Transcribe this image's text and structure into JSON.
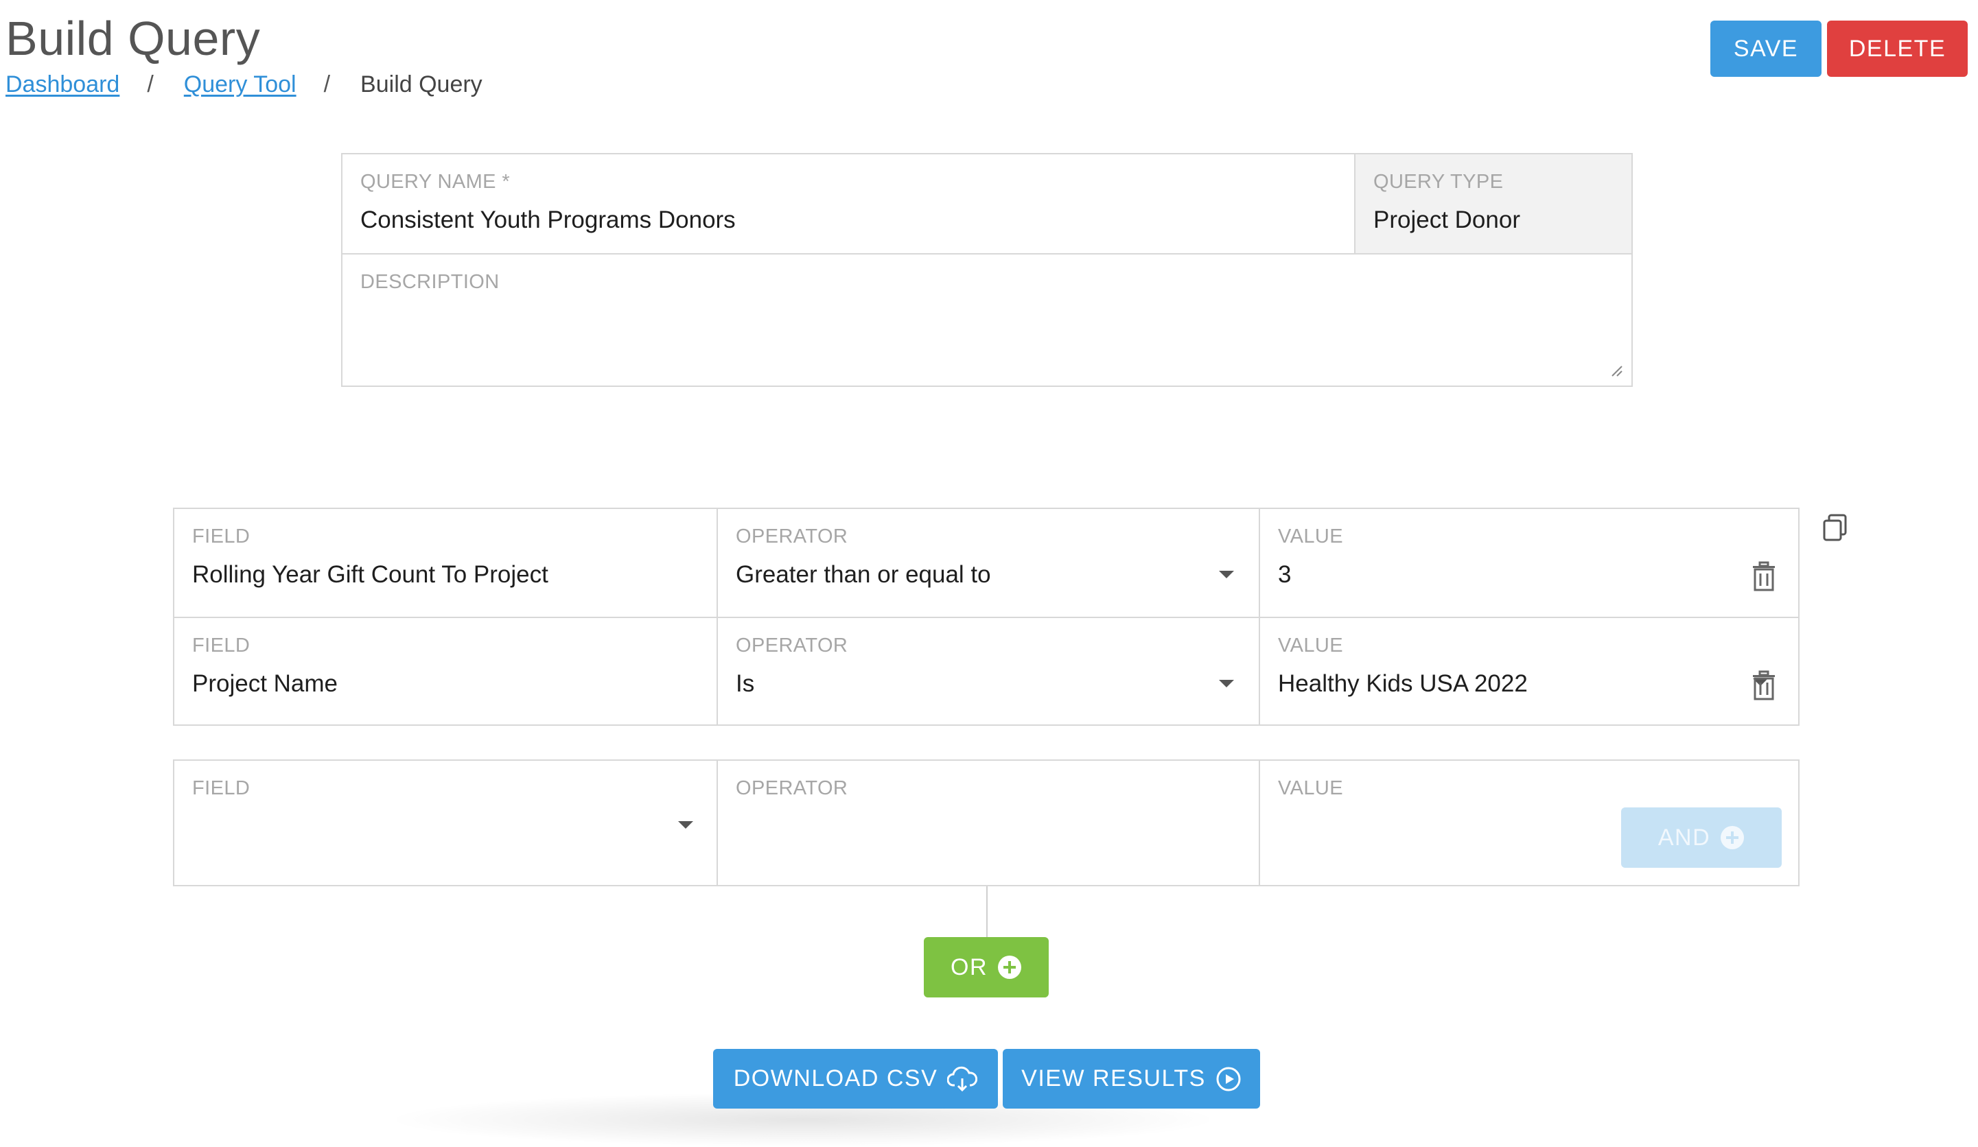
{
  "header": {
    "title": "Build Query",
    "breadcrumb": [
      "Dashboard",
      "Query Tool",
      "Build Query"
    ],
    "save_label": "SAVE",
    "delete_label": "DELETE"
  },
  "query": {
    "name_label": "QUERY NAME *",
    "name_value": "Consistent Youth Programs Donors",
    "type_label": "QUERY TYPE",
    "type_value": "Project Donor",
    "description_label": "DESCRIPTION",
    "description_value": ""
  },
  "conditions_group1": [
    {
      "field_label": "FIELD",
      "field_value": "Rolling Year Gift Count To Project",
      "operator_label": "OPERATOR",
      "operator_value": "Greater than or equal to",
      "value_label": "VALUE",
      "value_value": "3"
    },
    {
      "field_label": "FIELD",
      "field_value": "Project Name",
      "operator_label": "OPERATOR",
      "operator_value": "Is",
      "value_label": "VALUE",
      "value_value": "Healthy Kids USA 2022"
    }
  ],
  "new_condition": {
    "field_label": "FIELD",
    "field_value": "",
    "operator_label": "OPERATOR",
    "value_label": "VALUE",
    "and_label": "AND"
  },
  "or_label": "OR",
  "actions": {
    "download_label": "DOWNLOAD CSV",
    "view_label": "VIEW RESULTS"
  },
  "colors": {
    "primary": "#3d9be0",
    "danger": "#e0403f",
    "success": "#7ec242",
    "disabled": "#c6e2f5",
    "link": "#2f8fd8"
  },
  "icons": [
    "copy-icon",
    "trash-icon",
    "plus-circle-icon",
    "cloud-download-icon",
    "play-circle-icon",
    "chevron-down-icon",
    "resize-grip-icon"
  ]
}
